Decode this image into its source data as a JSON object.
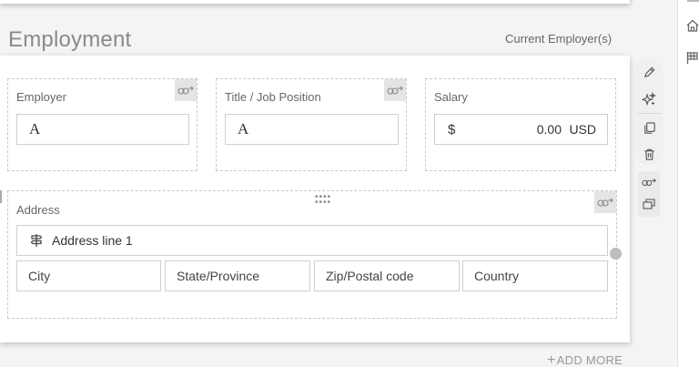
{
  "section": {
    "title": "Employment",
    "subtitle": "Current Employer(s)"
  },
  "fields": {
    "employer": {
      "label": "Employer",
      "font_icon": "A"
    },
    "title_position": {
      "label": "Title / Job Position",
      "font_icon": "A"
    },
    "salary": {
      "label": "Salary",
      "currency_symbol": "$",
      "value": "0.00",
      "unit": "USD"
    }
  },
  "address": {
    "label": "Address",
    "line1_placeholder": "Address line 1",
    "city_placeholder": "City",
    "state_placeholder": "State/Province",
    "zip_placeholder": "Zip/Postal code",
    "country_placeholder": "Country"
  },
  "footer": {
    "add_more_plus": "+",
    "add_more_label": "ADD MORE"
  },
  "icons": {
    "link": "link-icon",
    "edit": "pencil-icon",
    "ai": "sparkle-icon",
    "copy": "copy-icon",
    "delete": "trash-icon",
    "home": "home-icon",
    "flag": "flag-icon",
    "address": "signpost-icon"
  },
  "colors": {
    "card_bg": "#ffffff",
    "page_bg": "#f4f4f4",
    "border_dashed": "#c9c9c9",
    "title_gray": "#8a8a8a"
  }
}
